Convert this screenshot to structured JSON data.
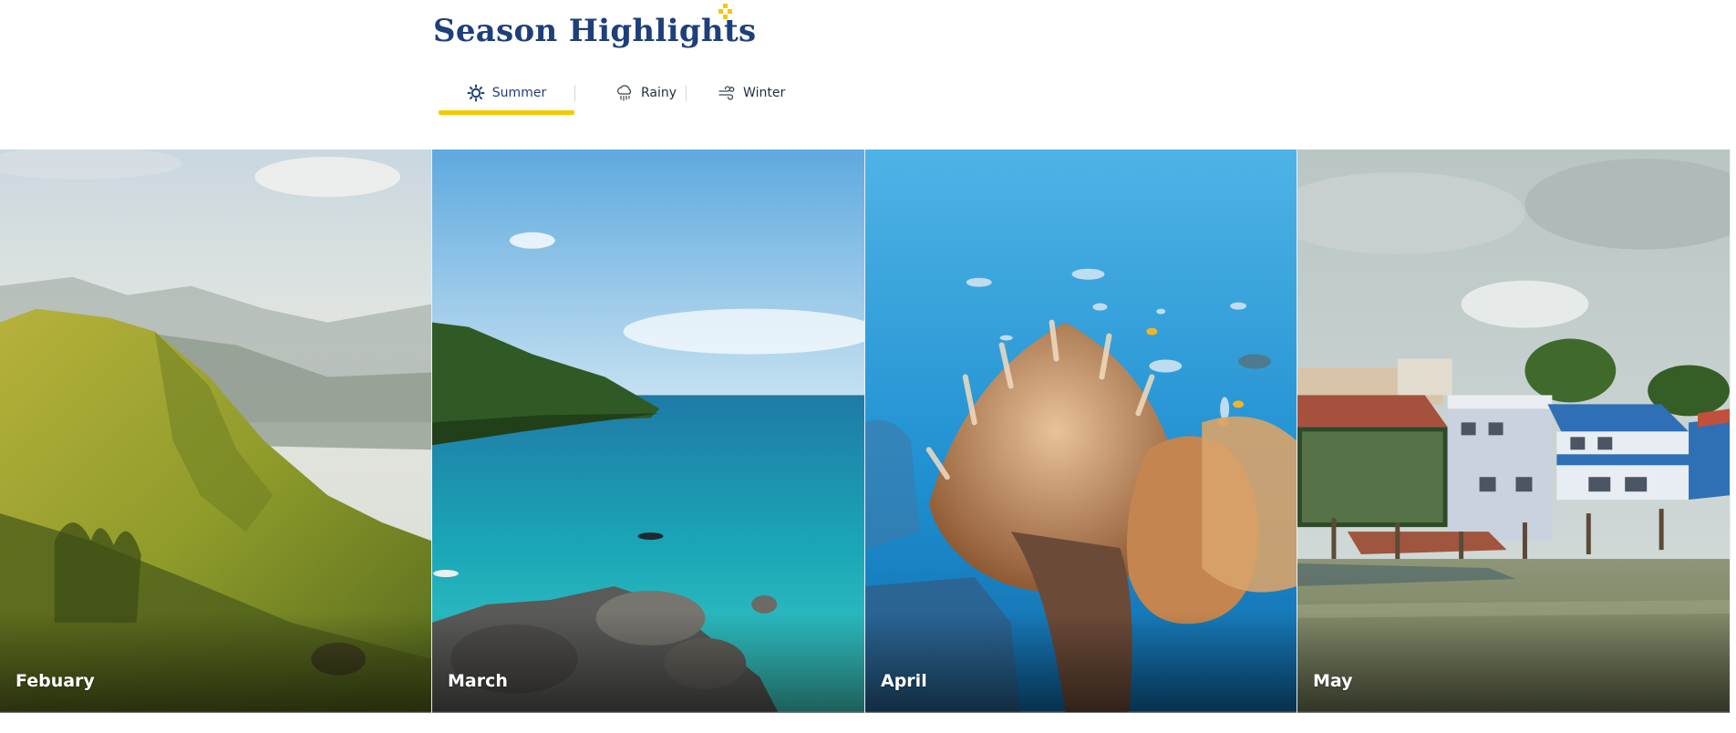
{
  "header": {
    "title": "Season Highlights",
    "accent_color": "#f5c900",
    "title_color": "#1e3f7a"
  },
  "tabs": [
    {
      "label": "Summer",
      "icon": "sun-icon",
      "active": true
    },
    {
      "label": "Rainy",
      "icon": "rain-cloud-icon",
      "active": false
    },
    {
      "label": "Winter",
      "icon": "wind-icon",
      "active": false
    }
  ],
  "cards": [
    {
      "label": "Febuary",
      "image": "green-mountain-ridge"
    },
    {
      "label": "March",
      "image": "turquoise-bay-coast"
    },
    {
      "label": "April",
      "image": "coral-reef-fish"
    },
    {
      "label": "May",
      "image": "riverside-stilt-houses"
    }
  ]
}
